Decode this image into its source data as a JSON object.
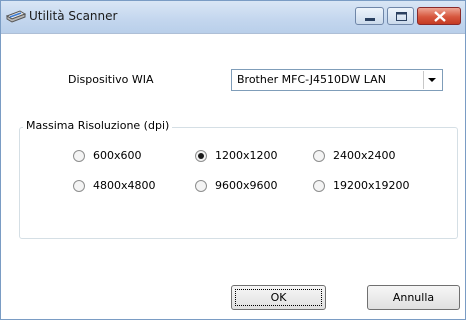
{
  "window": {
    "title": "Utilità Scanner"
  },
  "device": {
    "label": "Dispositivo WIA",
    "selected": "Brother MFC-J4510DW LAN"
  },
  "resolution": {
    "group_label": "Massima Risoluzione (dpi)",
    "options": [
      "600x600",
      "1200x1200",
      "2400x2400",
      "4800x4800",
      "9600x9600",
      "19200x19200"
    ],
    "selected": "1200x1200"
  },
  "buttons": {
    "ok": "OK",
    "cancel": "Annulla"
  },
  "colors": {
    "titlebar": "#c3d6ee",
    "close_button": "#d7573e"
  },
  "icons": [
    "scanner-icon",
    "minimize-icon",
    "maximize-icon",
    "close-icon",
    "dropdown-arrow-icon"
  ]
}
